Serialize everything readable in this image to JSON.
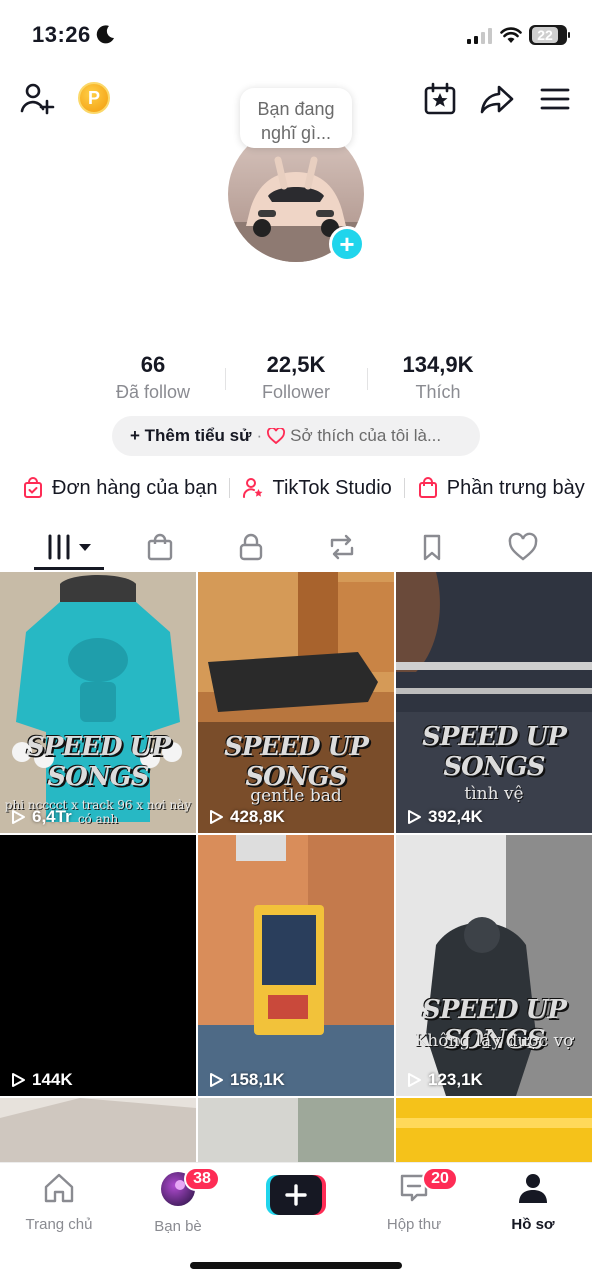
{
  "status_bar": {
    "time": "13:26",
    "battery": "22"
  },
  "thought_bubble": {
    "line1": "Bạn đang",
    "line2": "nghĩ gì..."
  },
  "stats": [
    {
      "value": "66",
      "label": "Đã follow"
    },
    {
      "value": "22,5K",
      "label": "Follower"
    },
    {
      "value": "134,9K",
      "label": "Thích"
    }
  ],
  "bio": {
    "add_label": "+ Thêm tiểu sử",
    "dot": "·",
    "hobby_label": "Sở thích của tôi là..."
  },
  "shortcuts": [
    {
      "label": "Đơn hàng của bạn",
      "icon": "shopping-bag-check-icon"
    },
    {
      "label": "TikTok Studio",
      "icon": "person-star-icon"
    },
    {
      "label": "Phần trưng bày",
      "icon": "shopping-bag-icon"
    }
  ],
  "tabs": [
    {
      "name": "videos",
      "icon": "grid-bars-icon",
      "active": true
    },
    {
      "name": "shop",
      "icon": "shopping-bag-icon"
    },
    {
      "name": "private",
      "icon": "lock-icon"
    },
    {
      "name": "reposts",
      "icon": "repost-icon"
    },
    {
      "name": "favorites",
      "icon": "bookmark-icon"
    },
    {
      "name": "liked",
      "icon": "heart-icon"
    }
  ],
  "videos": [
    {
      "views": "6,4Tr",
      "title": "SPEED UP SONGS",
      "caption": "phi ncccct x track 96 x nơi này có anh"
    },
    {
      "views": "428,8K",
      "title": "SPEED UP SONGS",
      "caption": "gentle bad"
    },
    {
      "views": "392,4K",
      "title": "SPEED UP SONGS",
      "caption": "tình vệ"
    },
    {
      "views": "144K"
    },
    {
      "views": "158,1K"
    },
    {
      "views": "123,1K",
      "title": "SPEED UP SONGS",
      "caption": "Không lấy được vợ"
    }
  ],
  "bottom_nav": {
    "home": "Trang chủ",
    "friends": "Bạn bè",
    "friends_badge": "38",
    "create": "+",
    "inbox": "Hộp thư",
    "inbox_badge": "20",
    "profile": "Hồ sơ"
  },
  "colors": {
    "accent": "#fe2c55",
    "teal": "#20d5ec",
    "text": "#161823",
    "muted": "#8a8b91"
  }
}
